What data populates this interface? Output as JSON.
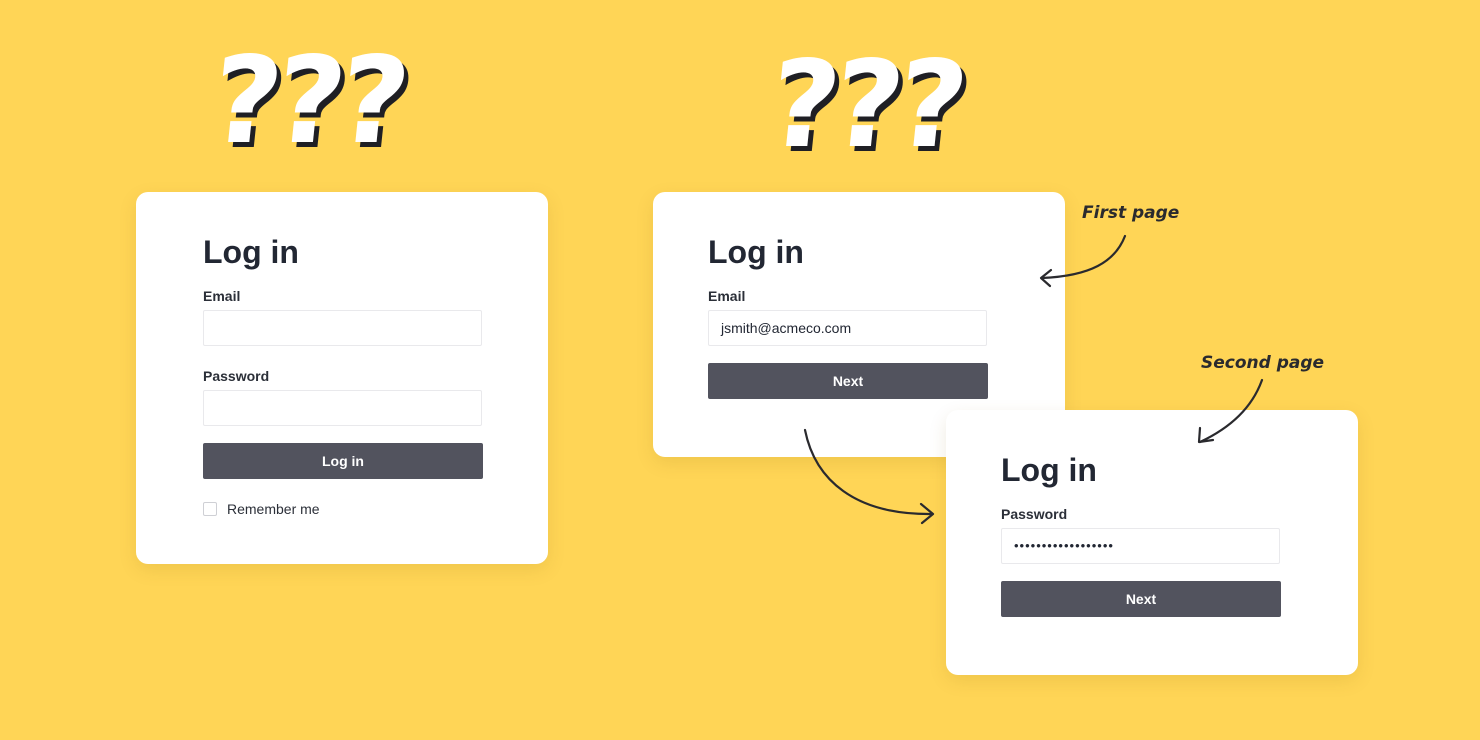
{
  "decorations": {
    "question_marks_left": "???",
    "question_marks_right": "???"
  },
  "classic_login": {
    "title": "Log in",
    "email_label": "Email",
    "email_value": "",
    "password_label": "Password",
    "password_value": "",
    "submit_label": "Log in",
    "remember_label": "Remember me",
    "remember_checked": false
  },
  "first_page": {
    "title": "Log in",
    "email_label": "Email",
    "email_value": "jsmith@acmeco.com",
    "next_label": "Next"
  },
  "second_page": {
    "title": "Log in",
    "password_label": "Password",
    "password_value": "••••••••••••••••••",
    "next_label": "Next"
  },
  "annotations": {
    "first": "First page",
    "second": "Second page"
  },
  "colors": {
    "background": "#FFD556",
    "card": "#FFFFFF",
    "button": "#52535E",
    "heading": "#222733"
  }
}
